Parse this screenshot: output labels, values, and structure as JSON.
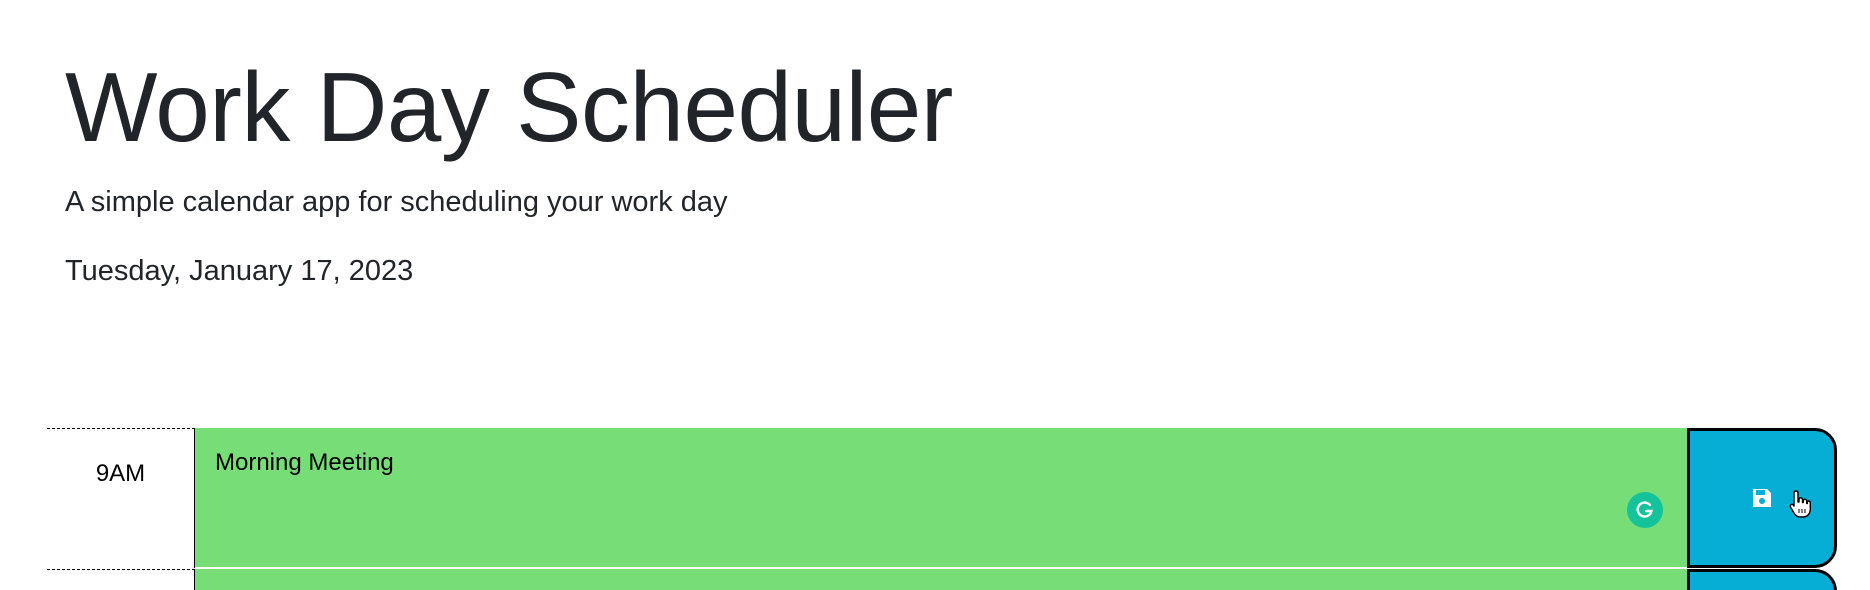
{
  "header": {
    "title": "Work Day Scheduler",
    "subtitle": "A simple calendar app for scheduling your work day",
    "current_day": "Tuesday, January 17, 2023"
  },
  "rows": [
    {
      "hour": "9AM",
      "description": "Morning Meeting",
      "status": "future",
      "status_color": "#77dd77",
      "save_icon": "floppy-disk-icon"
    },
    {
      "hour": "",
      "description": "",
      "status": "future",
      "status_color": "#77dd77",
      "save_icon": "floppy-disk-icon"
    }
  ],
  "colors": {
    "future": "#77dd77",
    "save_button": "#06aed5",
    "text": "#212529",
    "grammarly": "#15c39a"
  }
}
